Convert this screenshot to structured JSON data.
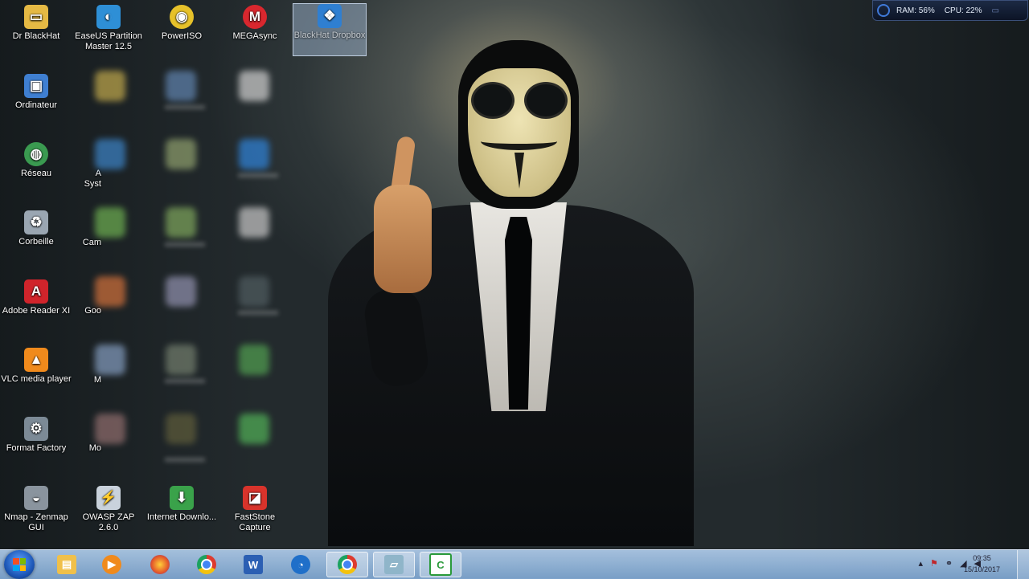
{
  "desktop": {
    "icons": [
      {
        "label": "Dr BlackHat",
        "icon": "folder-icon",
        "color": "#e5b944"
      },
      {
        "label": "EaseUS Partition Master 12.5",
        "icon": "easeus-icon",
        "color": "#2e8fd6"
      },
      {
        "label": "PowerISO",
        "icon": "poweriso-icon",
        "color": "#e6c12a"
      },
      {
        "label": "MEGAsync",
        "icon": "megasync-icon",
        "color": "#d9272e"
      },
      {
        "label": "BlackHat Dropbox",
        "icon": "dropbox-icon",
        "color": "#2f7fd1"
      },
      {
        "label": "Ordinateur",
        "icon": "computer-icon",
        "color": "#3f7fd1"
      },
      {
        "label": "Réseau",
        "icon": "network-icon",
        "color": "#3a9a50"
      },
      {
        "label": "Corbeille",
        "icon": "recycle-bin-icon",
        "color": "#9aa6b2"
      },
      {
        "label": "Adobe Reader XI",
        "icon": "adobe-reader-icon",
        "color": "#d0242b"
      },
      {
        "label": "VLC media player",
        "icon": "vlc-icon",
        "color": "#f08a1c"
      },
      {
        "label": "Format Factory",
        "icon": "format-factory-icon",
        "color": "#7c8a96"
      },
      {
        "label": "Nmap - Zenmap GUI",
        "icon": "nmap-icon",
        "color": "#8a949e"
      },
      {
        "label": "OWASP ZAP 2.6.0",
        "icon": "owasp-zap-icon",
        "color": "#c9d2dc"
      },
      {
        "label": "Internet Downlo...",
        "icon": "internet-download-manager-icon",
        "color": "#3aa24a"
      },
      {
        "label": "FastStone Capture",
        "icon": "faststone-capture-icon",
        "color": "#d8332b"
      }
    ],
    "partial_labels": [
      "A",
      "Syst",
      "Cam",
      "Goo",
      "M",
      "Mo"
    ]
  },
  "gadget": {
    "ram_text": "RAM: 56%",
    "cpu_text": "CPU: 22%"
  },
  "taskbar": {
    "buttons": [
      {
        "name": "windows-explorer",
        "icon": "folder-icon",
        "color": "#f0c04a"
      },
      {
        "name": "media-player",
        "icon": "media-player-icon",
        "color": "#f08a1c"
      },
      {
        "name": "firefox",
        "icon": "firefox-icon",
        "color": "#e4582a"
      },
      {
        "name": "chrome",
        "icon": "chrome-icon",
        "color": "#dd3b2f"
      },
      {
        "name": "word",
        "icon": "word-icon",
        "color": "#2b5fb3",
        "glyph": "W"
      },
      {
        "name": "ccleaner",
        "icon": "ccleaner-icon",
        "color": "#1f6fc9"
      },
      {
        "name": "chrome-active",
        "icon": "chrome-icon",
        "color": "#dd3b2f"
      },
      {
        "name": "disk-utility",
        "icon": "disk-icon",
        "color": "#8fb5c9"
      },
      {
        "name": "camtasia",
        "icon": "camtasia-icon",
        "color": "#2b9a3b",
        "glyph": "C"
      }
    ],
    "clock_time": "09:35",
    "clock_date": "15/10/2017"
  }
}
